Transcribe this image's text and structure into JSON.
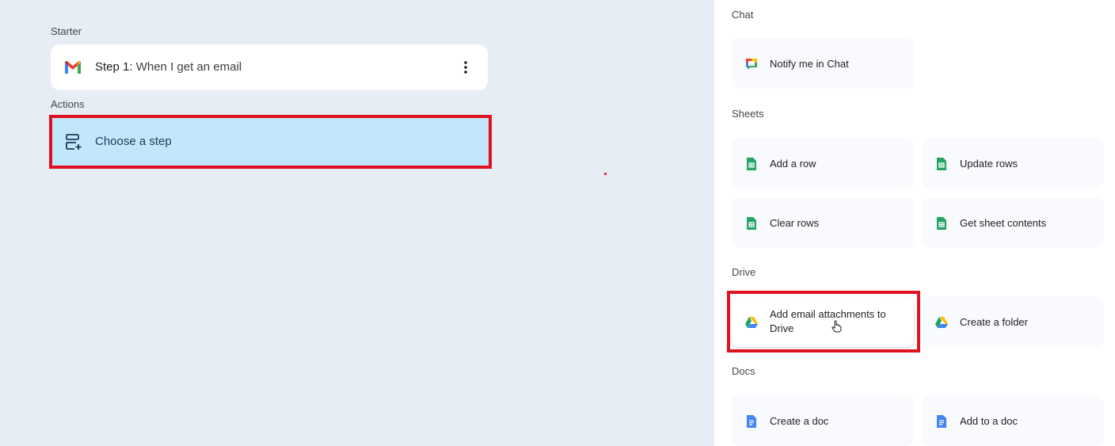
{
  "canvas": {
    "starter_label": "Starter",
    "step": {
      "prefix": "Step 1:",
      "text": "When I get an email",
      "icon": "gmail-icon",
      "menu_icon": "more-vert-icon"
    },
    "actions_label": "Actions",
    "choose_step": {
      "label": "Choose a step",
      "icon": "add-step-icon"
    }
  },
  "panel": {
    "categories": {
      "chat": "Chat",
      "sheets": "Sheets",
      "drive": "Drive",
      "docs": "Docs"
    },
    "chat_items": [
      "Notify me in Chat"
    ],
    "sheets_items": [
      "Add a row",
      "Update rows",
      "Clear rows",
      "Get sheet contents"
    ],
    "drive_items": [
      "Add email attachments to Drive",
      "Create a folder"
    ],
    "docs_items": [
      "Create a doc",
      "Add to a doc"
    ]
  },
  "colors": {
    "highlight": "#e0121f",
    "selected_step": "#c2e7fd",
    "sheets_green": "#23a566",
    "docs_blue": "#4285f4"
  }
}
